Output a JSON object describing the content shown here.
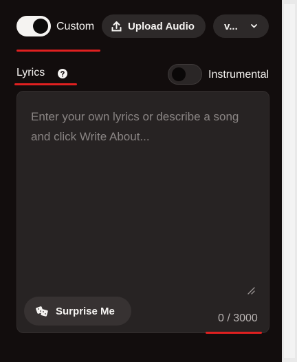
{
  "top_bar": {
    "custom_label": "Custom",
    "custom_toggle_on": true,
    "upload_label": "Upload Audio",
    "version_label": "v..."
  },
  "lyrics": {
    "label": "Lyrics",
    "instrumental_label": "Instrumental",
    "instrumental_toggle_on": false,
    "placeholder": "Enter your own lyrics or describe a song and click Write About...",
    "surprise_label": "Surprise Me",
    "char_count": "0 / 3000"
  },
  "colors": {
    "accent_underline": "#e02020",
    "panel_bg": "#120d0d"
  }
}
